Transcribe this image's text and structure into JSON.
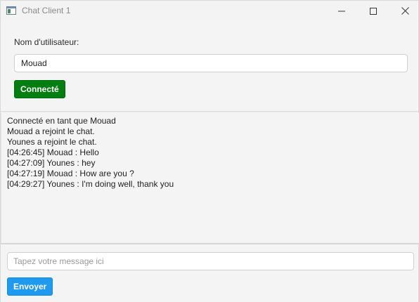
{
  "window": {
    "title": "Chat Client 1",
    "icons": [
      "app-icon",
      "minimize-icon",
      "maximize-icon",
      "close-icon"
    ]
  },
  "login": {
    "username_label": "Nom d'utilisateur:",
    "username_value": "Mouad",
    "connect_label": "Connecté"
  },
  "chat": {
    "messages": [
      "Connecté en tant que Mouad",
      "Mouad a rejoint le chat.",
      "Younes a rejoint le chat.",
      "[04:26:45] Mouad : Hello",
      "[04:27:09] Younes : hey",
      "[04:27:19] Mouad : How are you ?",
      "[04:29:27] Younes : I'm doing well, thank you"
    ]
  },
  "composer": {
    "placeholder": "Tapez votre message ici",
    "value": "",
    "send_label": "Envoyer"
  },
  "colors": {
    "connect_button": "#007e0f",
    "send_button": "#1e9bf0",
    "background": "#f3f3f3"
  }
}
